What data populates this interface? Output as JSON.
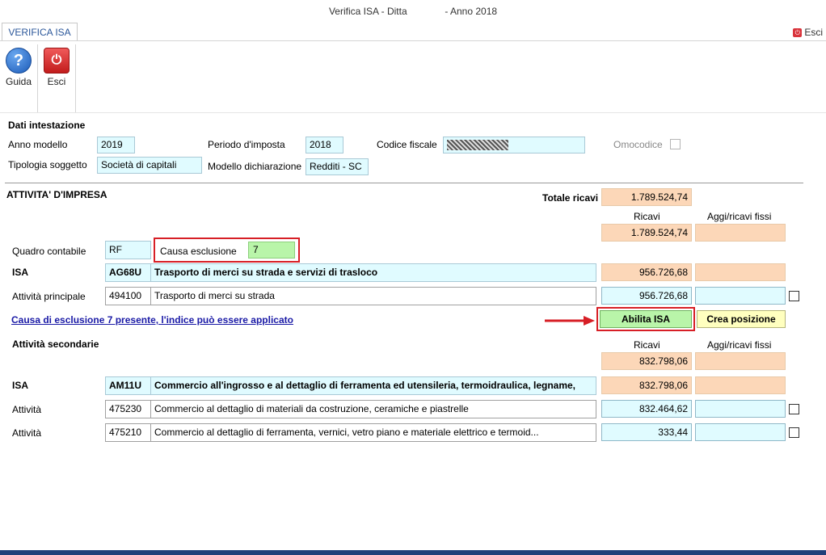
{
  "window": {
    "title": "Verifica ISA - Ditta              - Anno 2018"
  },
  "tab": {
    "label": "VERIFICA ISA"
  },
  "top_right": {
    "exit_label": "Esci"
  },
  "ribbon": {
    "help_label": "Guida",
    "exit_label": "Esci"
  },
  "intestazione": {
    "section_title": "Dati intestazione",
    "anno_modello_label": "Anno modello",
    "anno_modello_value": "2019",
    "periodo_label": "Periodo d'imposta",
    "periodo_value": "2018",
    "codice_fiscale_label": "Codice fiscale",
    "omocodice_label": "Omocodice",
    "tipologia_label": "Tipologia soggetto",
    "tipologia_value": "Società di capitali",
    "modello_label": "Modello dichiarazione",
    "modello_value": "Redditi - SC"
  },
  "impresa": {
    "section_title": "ATTIVITA' D'IMPRESA",
    "totale_ricavi_label": "Totale ricavi",
    "totale_ricavi_value": "1.789.524,74",
    "col_ricavi": "Ricavi",
    "col_aggi": "Aggi/ricavi fissi",
    "ricavi_total": "1.789.524,74",
    "quadro_label": "Quadro contabile",
    "quadro_value": "RF",
    "causa_label": "Causa esclusione",
    "causa_value": "7",
    "isa_label": "ISA",
    "isa_code": "AG68U",
    "isa_desc": "Trasporto di merci su strada e servizi di trasloco",
    "isa_ricavi": "956.726,68",
    "principale_label": "Attività principale",
    "principale_code": "494100",
    "principale_desc": "Trasporto di merci su strada",
    "principale_ricavi": "956.726,68",
    "link_text": "Causa di esclusione 7 presente, l'indice può essere applicato",
    "btn_abilita": "Abilita ISA",
    "btn_crea": "Crea posizione"
  },
  "secondarie": {
    "section_title": "Attività secondarie",
    "col_ricavi": "Ricavi",
    "col_aggi": "Aggi/ricavi fissi",
    "ricavi_total": "832.798,06",
    "isa_label": "ISA",
    "isa_code": "AM11U",
    "isa_desc": "Commercio all'ingrosso e al dettaglio di ferramenta ed utensileria, termoidraulica, legname,",
    "isa_ricavi": "832.798,06",
    "rows": [
      {
        "label": "Attività",
        "code": "475230",
        "desc": "Commercio al dettaglio di materiali da costruzione, ceramiche e piastrelle",
        "ricavi": "832.464,62"
      },
      {
        "label": "Attività",
        "code": "475210",
        "desc": "Commercio al dettaglio di ferramenta, vernici, vetro piano e materiale elettrico e termoid...",
        "ricavi": "333,44"
      }
    ]
  },
  "colors": {
    "peach": "#fcd7b8",
    "cyan": "#e0fbff",
    "accent_red": "#d71f26",
    "green_button": "#b9f5a9",
    "yellow_button": "#ffffbf",
    "link": "#1a1aa6"
  }
}
